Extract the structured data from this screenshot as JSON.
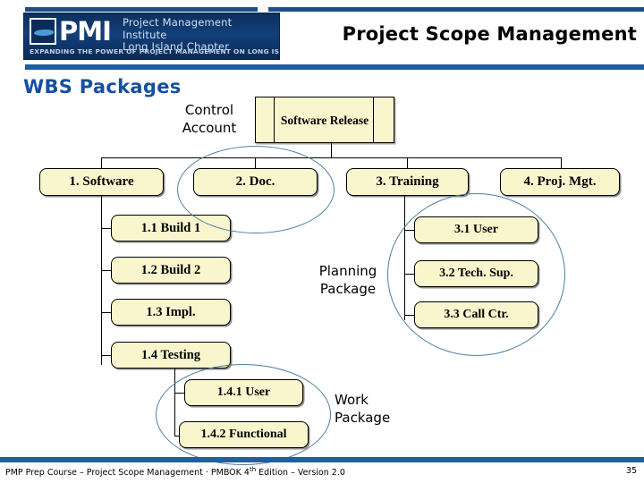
{
  "header": {
    "logo": {
      "brand": "PMI",
      "line1": "Project Management Institute",
      "line2": "Long Island Chapter",
      "tagline": "EXPANDING THE POWER OF PROJECT MANAGEMENT ON LONG ISLAND",
      "accent_color": "#1f5fa0"
    },
    "title": "Project Scope Management"
  },
  "section": {
    "heading": "WBS Packages",
    "heading_color": "#15509e"
  },
  "diagram": {
    "root": {
      "label": "Software Release"
    },
    "annotations": {
      "control_account": "Control\nAccount",
      "control_account_line1": "Control",
      "control_account_line2": "Account",
      "planning_package_line1": "Planning",
      "planning_package_line2": "Package",
      "work_package_line1": "Work",
      "work_package_line2": "Package"
    },
    "level1": [
      {
        "label": "1. Software"
      },
      {
        "label": "2. Doc."
      },
      {
        "label": "3. Training"
      },
      {
        "label": "4. Proj. Mgt."
      }
    ],
    "software_children": [
      {
        "label": "1.1 Build 1"
      },
      {
        "label": "1.2 Build 2"
      },
      {
        "label": "1.3 Impl."
      },
      {
        "label": "1.4 Testing"
      }
    ],
    "testing_children": [
      {
        "label": "1.4.1 User"
      },
      {
        "label": "1.4.2 Functional"
      }
    ],
    "training_children": [
      {
        "label": "3.1 User"
      },
      {
        "label": "3.2 Tech. Sup."
      },
      {
        "label": "3.3 Call Ctr."
      }
    ],
    "node_fill": "#f9f6ce",
    "ellipse_color": "#4e7f9e"
  },
  "footer": {
    "text_before": "PMP Prep Course – Project Scope Management · PMBOK 4",
    "text_sup": "th",
    "text_after": " Edition – Version 2.0",
    "page": "35"
  }
}
